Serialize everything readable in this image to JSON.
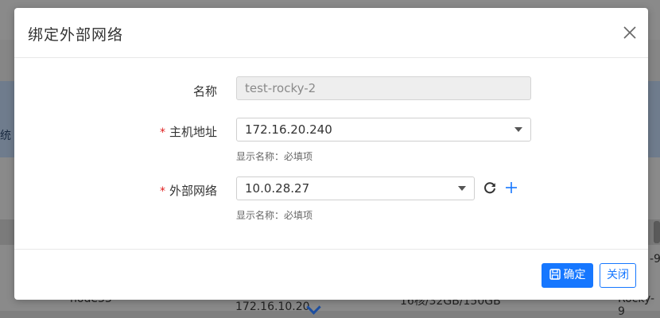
{
  "background": {
    "left_word": "统",
    "row": {
      "node": "node33",
      "ip": "172.16.10.20",
      "spec": "16核/32GB/150GB",
      "os": "Rocky-9"
    },
    "right_edge_text": "-9"
  },
  "modal": {
    "title": "绑定外部网络",
    "fields": {
      "name": {
        "label": "名称",
        "value": "test-rocky-2"
      },
      "host": {
        "required_mark": "*",
        "label": "主机地址",
        "value": "172.16.20.240",
        "hint": "显示名称：必填项"
      },
      "network": {
        "required_mark": "*",
        "label": "外部网络",
        "value": "10.0.28.27",
        "hint": "显示名称：必填项"
      }
    },
    "footer": {
      "confirm_label": "确定",
      "close_label": "关闭"
    }
  },
  "colors": {
    "primary": "#1677ff",
    "required": "#e02020"
  }
}
